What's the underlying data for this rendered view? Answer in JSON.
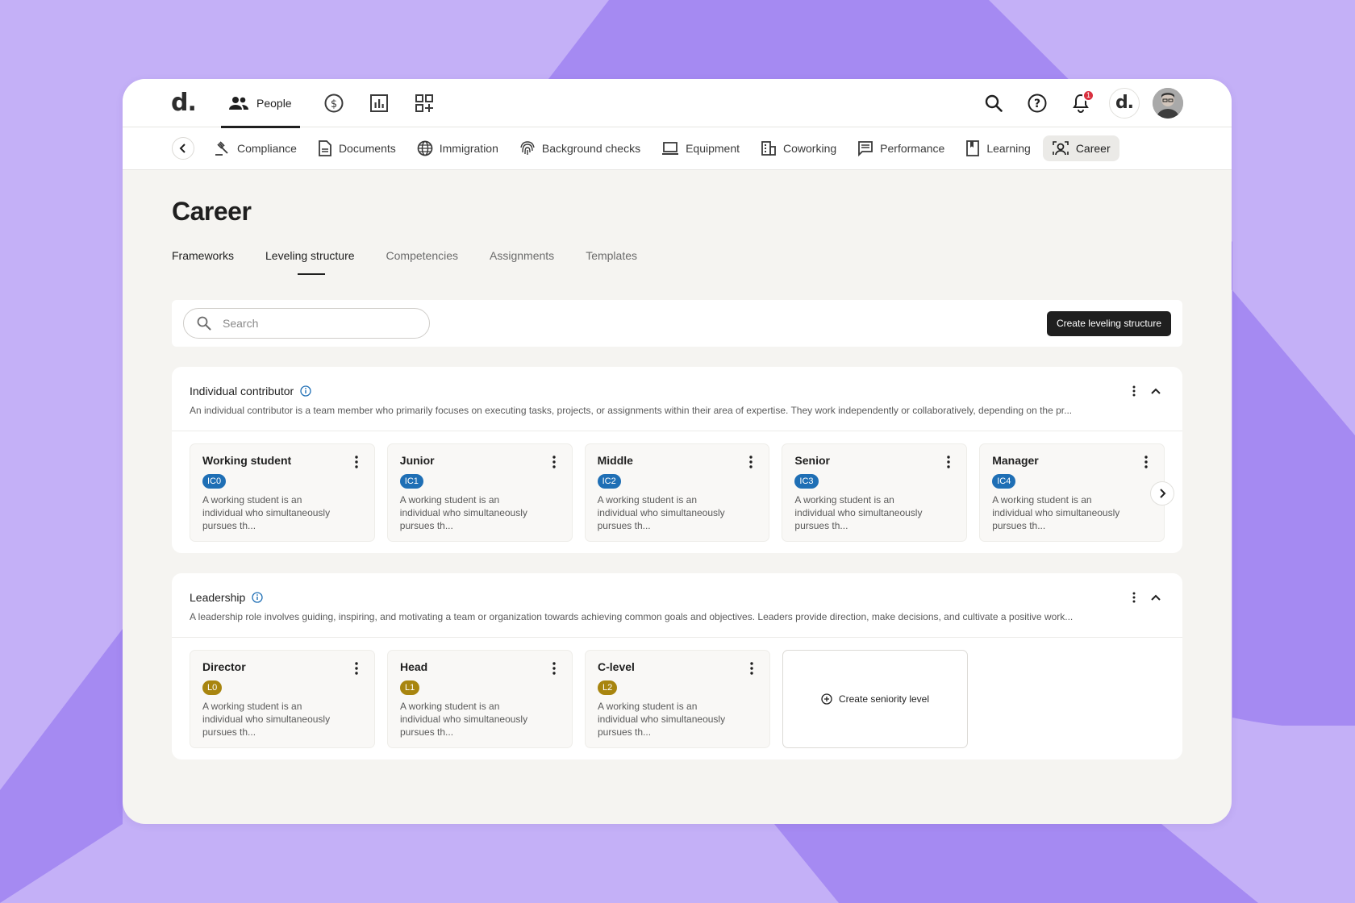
{
  "app": {
    "logo": "d.",
    "people_label": "People",
    "notification_count": "1",
    "company_logo": "d."
  },
  "icons": {
    "people": "people-icon",
    "payments": "dollar-circle-icon",
    "reports": "bar-chart-icon",
    "apps": "apps-add-icon",
    "search": "search-icon",
    "help": "help-icon",
    "bell": "bell-icon"
  },
  "subnav": {
    "items": [
      {
        "label": "Compliance",
        "icon": "gavel-icon"
      },
      {
        "label": "Documents",
        "icon": "document-icon"
      },
      {
        "label": "Immigration",
        "icon": "globe-icon"
      },
      {
        "label": "Background checks",
        "icon": "fingerprint-icon"
      },
      {
        "label": "Equipment",
        "icon": "laptop-icon"
      },
      {
        "label": "Coworking",
        "icon": "building-icon"
      },
      {
        "label": "Performance",
        "icon": "feedback-icon"
      },
      {
        "label": "Learning",
        "icon": "bookmark-icon"
      },
      {
        "label": "Career",
        "icon": "career-icon"
      }
    ]
  },
  "page": {
    "title": "Career",
    "tabs": [
      "Frameworks",
      "Leveling structure",
      "Competencies",
      "Assignments",
      "Templates"
    ],
    "active_tab": "Leveling structure",
    "search_placeholder": "Search",
    "create_button": "Create leveling structure"
  },
  "sections": [
    {
      "title": "Individual contributor",
      "description": "An individual contributor is a team member who primarily focuses on executing tasks, projects, or assignments within their area of expertise. They work independently or collaboratively, depending on the pr...",
      "cards": [
        {
          "title": "Working student",
          "code": "IC0",
          "text": "A working student is an individual who simultaneously pursues th..."
        },
        {
          "title": "Junior",
          "code": "IC1",
          "text": "A working student is an individual who simultaneously pursues th..."
        },
        {
          "title": "Middle",
          "code": "IC2",
          "text": "A working student is an individual who simultaneously pursues th..."
        },
        {
          "title": "Senior",
          "code": "IC3",
          "text": "A working student is an individual who simultaneously pursues th..."
        },
        {
          "title": "Manager",
          "code": "IC4",
          "text": "A working student is an individual who simultaneously pursues th..."
        }
      ]
    },
    {
      "title": "Leadership",
      "description": "A leadership role involves guiding, inspiring, and motivating a team or organization towards achieving common goals and objectives. Leaders provide direction, make decisions, and cultivate a positive work...",
      "cards": [
        {
          "title": "Director",
          "code": "L0",
          "text": "A working student is an individual who simultaneously pursues th..."
        },
        {
          "title": "Head",
          "code": "L1",
          "text": "A working student is an individual who simultaneously pursues th..."
        },
        {
          "title": "C-level",
          "code": "L2",
          "text": "A working student is an individual who simultaneously pursues th..."
        }
      ],
      "create_label": "Create seniority level"
    }
  ],
  "colors": {
    "ic_pill": "#1f6fb5",
    "leadership_pill": "#a8850f",
    "primary_button": "#1f1f1f",
    "background": "#c4b0f7"
  }
}
